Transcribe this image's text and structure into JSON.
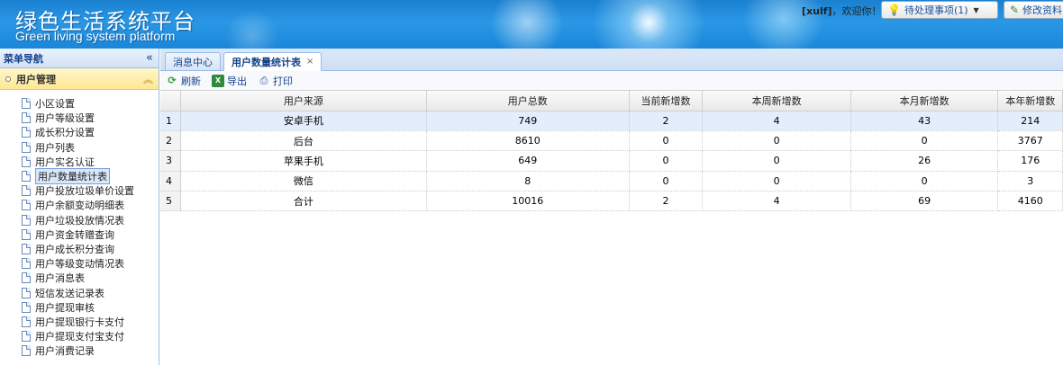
{
  "header": {
    "title_cn": "绿色生活系统平台",
    "title_en": "Green living system platform",
    "username": "[xulf]",
    "welcome": "，欢迎你！",
    "pending_label": "待处理事项(1)",
    "modify_label": "修改资料"
  },
  "sidebar": {
    "title": "菜单导航",
    "group_title": "用户管理",
    "items": [
      {
        "label": "小区设置"
      },
      {
        "label": "用户等级设置"
      },
      {
        "label": "成长积分设置"
      },
      {
        "label": "用户列表"
      },
      {
        "label": "用户实名认证"
      },
      {
        "label": "用户数量统计表"
      },
      {
        "label": "用户投放垃圾单价设置"
      },
      {
        "label": "用户余额变动明细表"
      },
      {
        "label": "用户垃圾投放情况表"
      },
      {
        "label": "用户资金转赠查询"
      },
      {
        "label": "用户成长积分查询"
      },
      {
        "label": "用户等级变动情况表"
      },
      {
        "label": "用户消息表"
      },
      {
        "label": "短信发送记录表"
      },
      {
        "label": "用户提现审核"
      },
      {
        "label": "用户提现银行卡支付"
      },
      {
        "label": "用户提现支付宝支付"
      },
      {
        "label": "用户消费记录"
      }
    ]
  },
  "tabs": [
    {
      "label": "消息中心"
    },
    {
      "label": "用户数量统计表"
    }
  ],
  "toolbar": {
    "refresh": "刷新",
    "export": "导出",
    "print": "打印"
  },
  "table": {
    "columns": [
      "用户来源",
      "用户总数",
      "当前新增数",
      "本周新增数",
      "本月新增数",
      "本年新增数"
    ],
    "rows": [
      {
        "n": "1",
        "cells": [
          "安卓手机",
          "749",
          "2",
          "4",
          "43",
          "214"
        ]
      },
      {
        "n": "2",
        "cells": [
          "后台",
          "8610",
          "0",
          "0",
          "0",
          "3767"
        ]
      },
      {
        "n": "3",
        "cells": [
          "苹果手机",
          "649",
          "0",
          "0",
          "26",
          "176"
        ]
      },
      {
        "n": "4",
        "cells": [
          "微信",
          "8",
          "0",
          "0",
          "0",
          "3"
        ]
      },
      {
        "n": "5",
        "cells": [
          "合计",
          "10016",
          "2",
          "4",
          "69",
          "4160"
        ]
      }
    ]
  }
}
